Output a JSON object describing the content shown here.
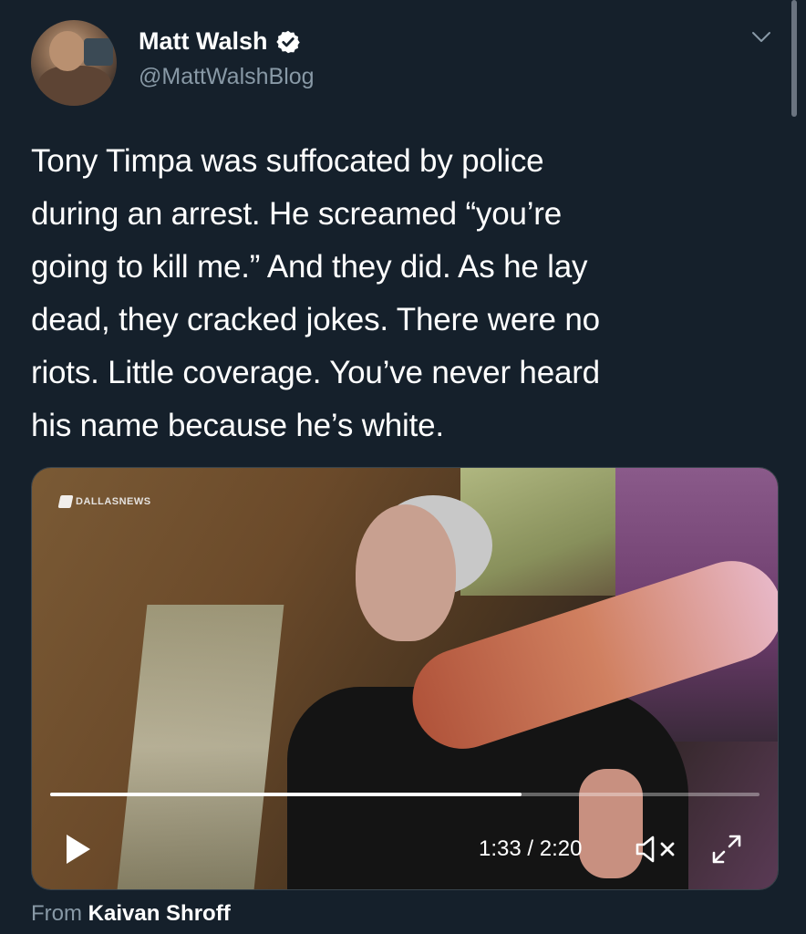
{
  "tweet": {
    "author": {
      "display_name": "Matt Walsh",
      "handle": "@MattWalshBlog",
      "verified": true
    },
    "text_lines": [
      "Tony Timpa was suffocated by police",
      "during an arrest. He screamed “you’re",
      "going to kill me.” And they did. As he lay",
      "dead, they cracked jokes. There were no",
      "riots. Little coverage. You’ve never heard",
      "his name because he’s white."
    ]
  },
  "video": {
    "watermark": "DALLASNEWS",
    "current_time": "1:33",
    "duration": "2:20",
    "time_display": "1:33 / 2:20",
    "progress_fraction": 0.664,
    "muted": true
  },
  "source": {
    "prefix": "From",
    "name": "Kaivan Shroff"
  },
  "colors": {
    "background": "#15202b",
    "text_primary": "#ffffff",
    "text_secondary": "#8899a6",
    "verified_badge": "#ffffff"
  },
  "icons": {
    "verified": "verified-badge-icon",
    "menu": "chevron-down-icon",
    "play": "play-icon",
    "mute": "speaker-muted-icon",
    "fullscreen": "fullscreen-icon"
  }
}
